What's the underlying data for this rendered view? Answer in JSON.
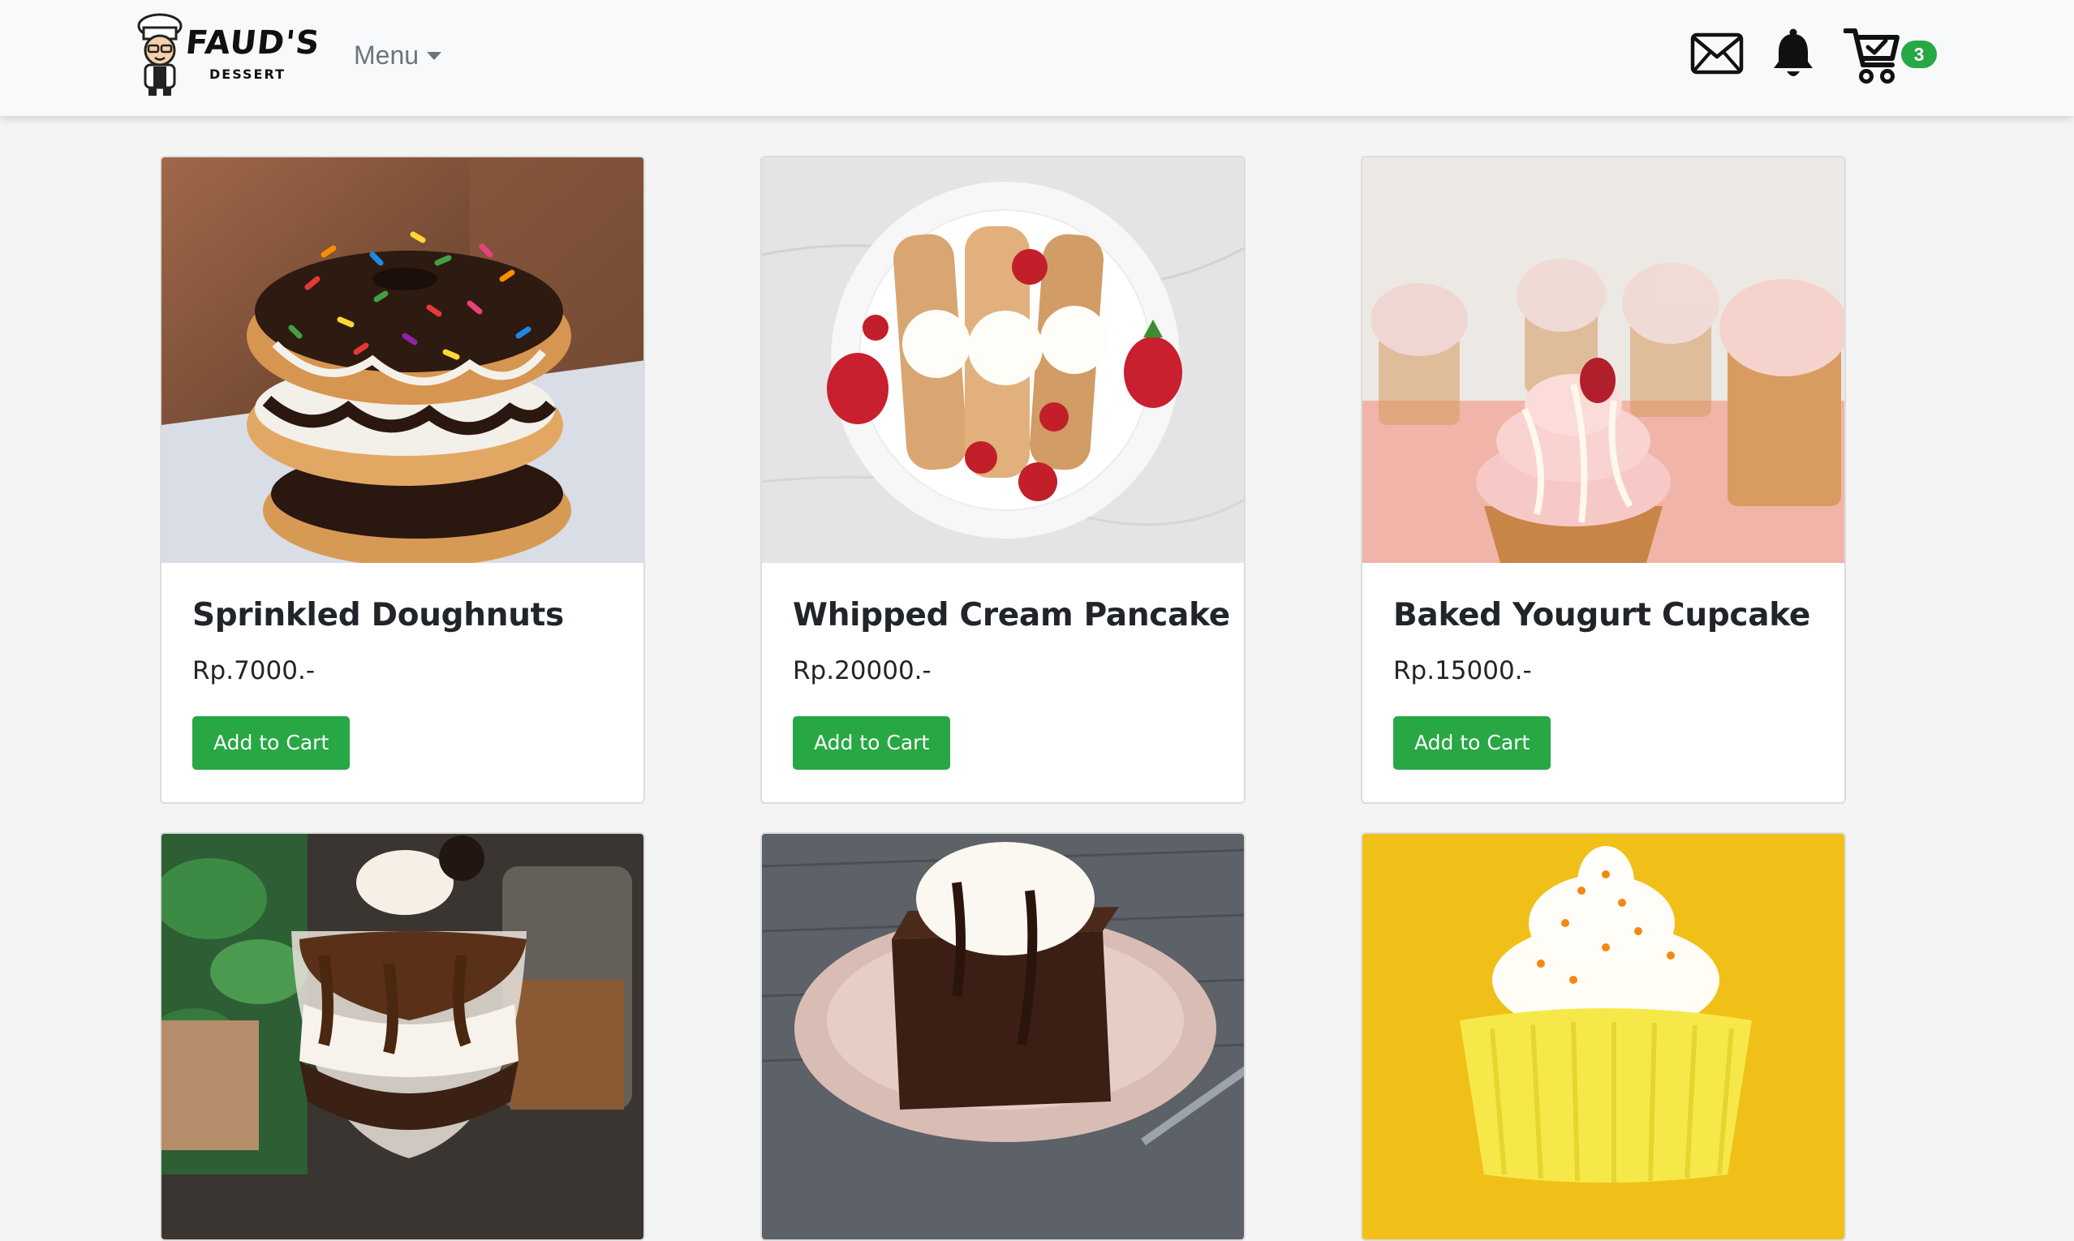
{
  "brand": {
    "name": "FAUD'S",
    "tagline": "DESSERT"
  },
  "nav": {
    "menu_label": "Menu",
    "cart_count": "3"
  },
  "icons": [
    "logo-chef-icon",
    "mail-icon",
    "bell-icon",
    "cart-icon"
  ],
  "colors": {
    "accent_green": "#28a745",
    "navbar_bg": "#f8f9fa",
    "page_bg": "#f4f4f4",
    "menu_text": "#6c757d"
  },
  "products": [
    {
      "name": "Sprinkled Doughnuts",
      "price": "Rp.7000.-",
      "button": "Add to Cart",
      "image": "doughnut-photo"
    },
    {
      "name": "Whipped Cream Pancake",
      "price": "Rp.20000.-",
      "button": "Add to Cart",
      "image": "pancake-photo"
    },
    {
      "name": "Baked Yougurt Cupcake",
      "price": "Rp.15000.-",
      "button": "Add to Cart",
      "image": "cupcake-photo"
    },
    {
      "name": "",
      "price": "",
      "button": "",
      "image": "chocolate-parfait-photo"
    },
    {
      "name": "",
      "price": "",
      "button": "",
      "image": "brownie-photo"
    },
    {
      "name": "",
      "price": "",
      "button": "",
      "image": "yellow-cupcake-photo"
    }
  ]
}
